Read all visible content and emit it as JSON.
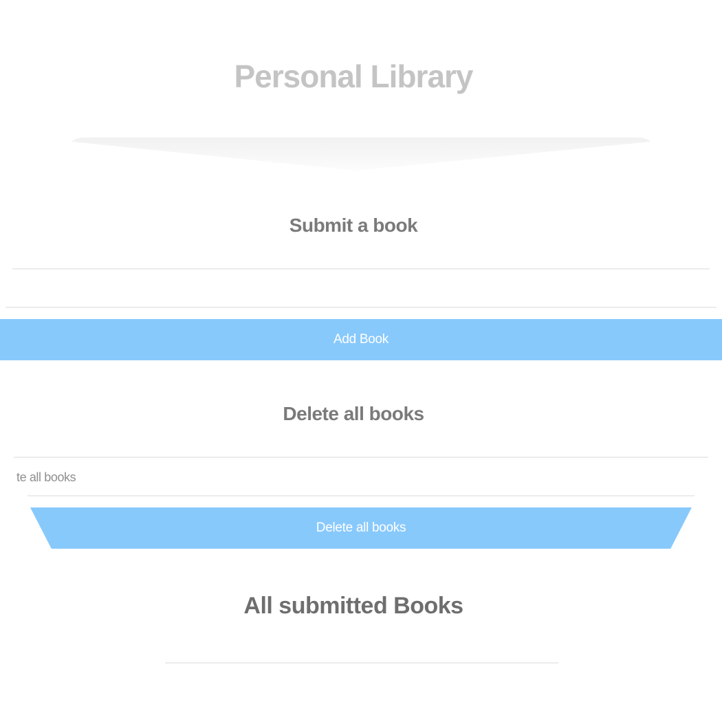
{
  "header": {
    "title": "Personal Library"
  },
  "submit_section": {
    "title": "Submit a book",
    "book_title_input": {
      "value": "",
      "placeholder": ""
    },
    "add_button_label": "Add Book"
  },
  "delete_section": {
    "title": "Delete all books",
    "confirm_input": {
      "visible_text": "te all books"
    },
    "delete_button_label": "Delete all books"
  },
  "books_section": {
    "title": "All submitted Books"
  },
  "colors": {
    "button_background": "#88c9fc",
    "button_text": "#ffffff",
    "title_text": "#c4c4c4",
    "heading_text": "#7a7a7a",
    "divider": "#ececec"
  }
}
